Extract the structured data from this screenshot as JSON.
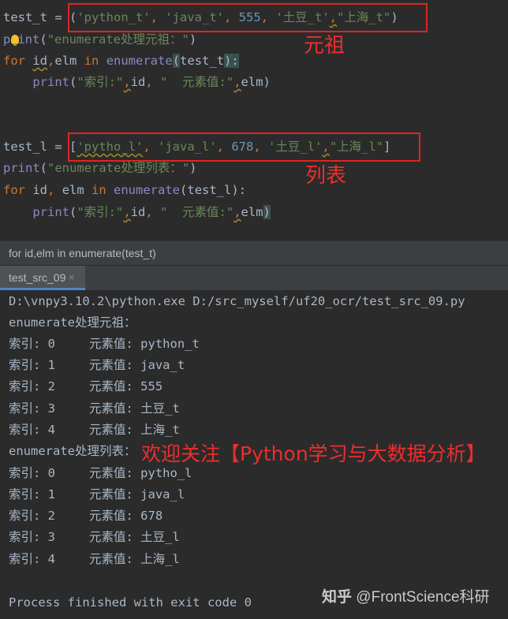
{
  "editor": {
    "line1": {
      "var": "test_t",
      "eq": " = ",
      "open": "(",
      "s1": "'python_t'",
      "c1": ", ",
      "s2": "'java_t'",
      "c2": ", ",
      "n": "555",
      "c3": ", ",
      "s3": "'土豆_t'",
      "c4": ",",
      "s4": "\"上海_t\"",
      "close": ")"
    },
    "line2": {
      "fn_pre": "p",
      "fn_post": "int",
      "open": "(",
      "str": "\"enumerate处理元祖：\"",
      "close": ")"
    },
    "line3": {
      "kw_for": "for",
      "space": " ",
      "id": "id",
      "comma": ",",
      "elm": "elm",
      "kw_in": " in ",
      "fn": "enumerate",
      "open": "(",
      "arg": "test_t",
      "close": "):"
    },
    "line4": {
      "indent": "    ",
      "fn": "print",
      "open": "(",
      "s1": "\"索引:\"",
      "c1": ",",
      "id": "id",
      "c2": ", ",
      "s2": "\"  元素值:\"",
      "c3": ",",
      "elm": "elm",
      "close": ")"
    },
    "line5": {
      "var": "test_l",
      "eq": " = ",
      "open": "[",
      "s1": "'pytho_l'",
      "c1": ", ",
      "s2": "'java_l'",
      "c2": ", ",
      "n": "678",
      "c3": ", ",
      "s3": "'土豆_l'",
      "c4": ",",
      "s4": "\"上海_l\"",
      "close": "]"
    },
    "line6": {
      "fn": "print",
      "open": "(",
      "str": "\"enumerate处理列表：\"",
      "close": ")"
    },
    "line7": {
      "kw_for": "for",
      "space": " ",
      "id": "id",
      "comma": ", ",
      "elm": "elm",
      "kw_in": " in ",
      "fn": "enumerate",
      "open": "(",
      "arg": "test_l",
      "close": "):"
    },
    "line8": {
      "indent": "    ",
      "fn": "print",
      "open": "(",
      "s1": "\"索引:\"",
      "c1": ",",
      "id": "id",
      "c2": ", ",
      "s2": "\"  元素值:\"",
      "c3": ",",
      "elm": "elm",
      "close": ")"
    },
    "annotation_tuple": "元祖",
    "annotation_list": "列表"
  },
  "breadcrumb": "for id,elm in enumerate(test_t)",
  "run_tab": {
    "label": "test_src_09",
    "close": "×"
  },
  "console": {
    "command": "D:\\vnpy3.10.2\\python.exe D:/src_myself/uf20_ocr/test_src_09.py",
    "header_tuple": "enumerate处理元祖：",
    "tuple_rows": [
      {
        "idx": "索引: 0",
        "val": "元素值: python_t"
      },
      {
        "idx": "索引: 1",
        "val": "元素值: java_t"
      },
      {
        "idx": "索引: 2",
        "val": "元素值: 555"
      },
      {
        "idx": "索引: 3",
        "val": "元素值: 土豆_t"
      },
      {
        "idx": "索引: 4",
        "val": "元素值: 上海_t"
      }
    ],
    "header_list": "enumerate处理列表：",
    "list_rows": [
      {
        "idx": "索引: 0",
        "val": "元素值: pytho_l"
      },
      {
        "idx": "索引: 1",
        "val": "元素值: java_l"
      },
      {
        "idx": "索引: 2",
        "val": "元素值: 678"
      },
      {
        "idx": "索引: 3",
        "val": "元素值: 土豆_l"
      },
      {
        "idx": "索引: 4",
        "val": "元素值: 上海_l"
      }
    ],
    "exit": "Process finished with exit code 0",
    "promo": "欢迎关注【Python学习与大数据分析】",
    "watermark": {
      "logo": "知乎",
      "handle": "@FrontScience科研"
    }
  },
  "colors": {
    "keyword": "#cc7832",
    "builtin": "#8888c6",
    "string": "#6a8759",
    "number": "#6897bb",
    "annotation": "#e02424"
  }
}
